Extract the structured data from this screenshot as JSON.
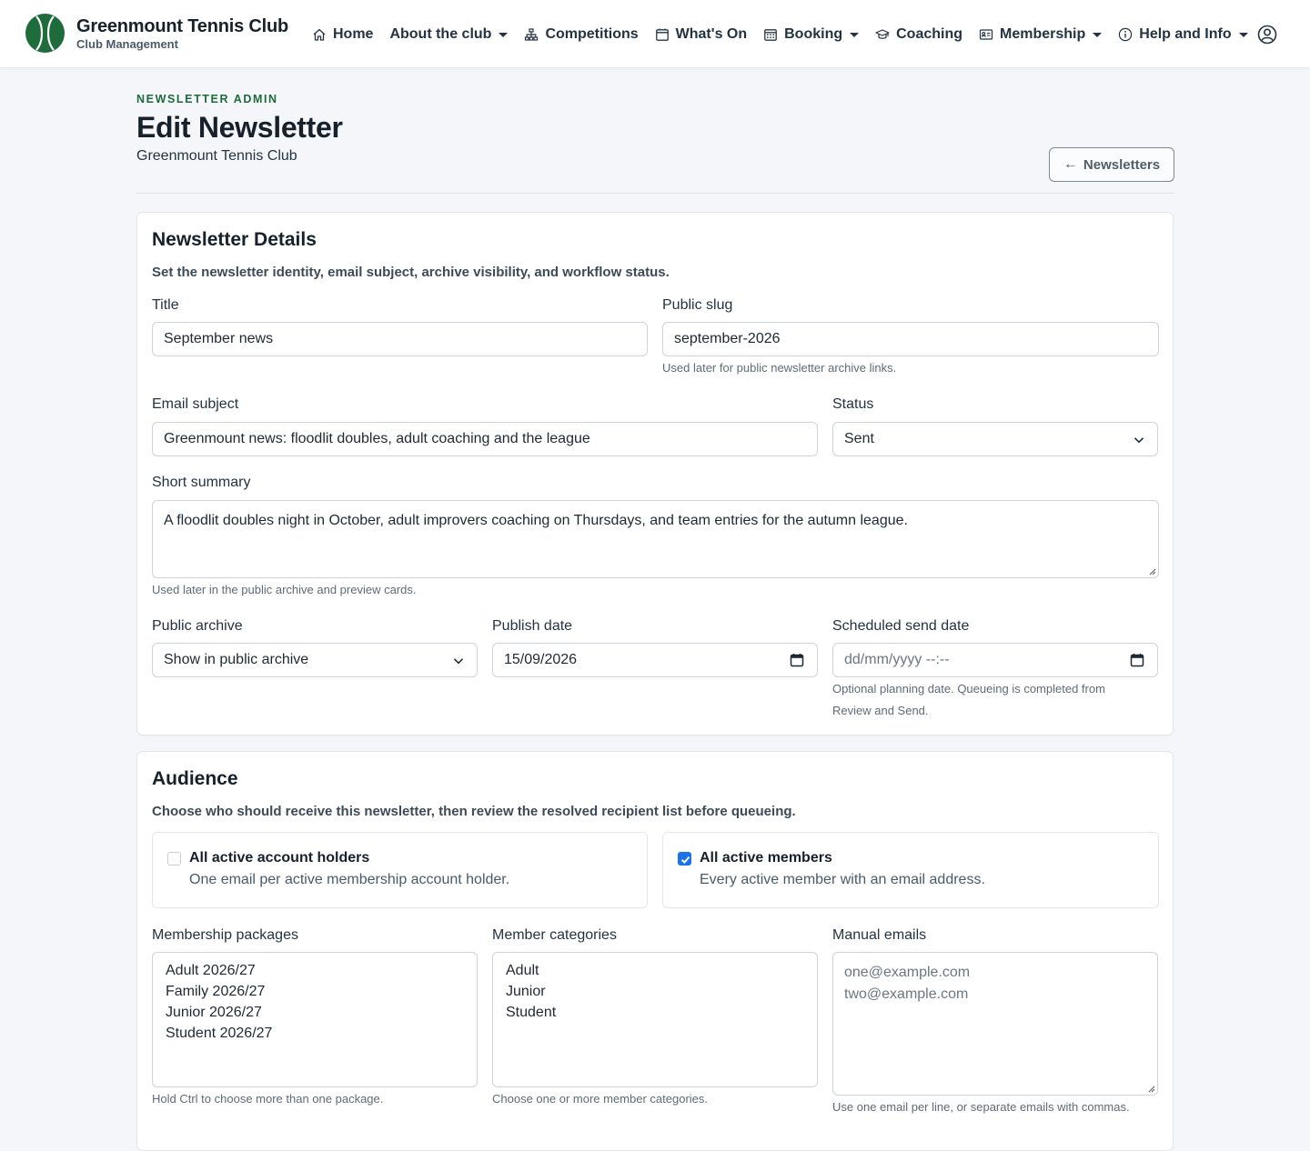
{
  "brand": {
    "name": "Greenmount Tennis Club",
    "subtitle": "Club Management"
  },
  "nav": {
    "items": [
      {
        "label": "Home",
        "icon": "home-icon"
      },
      {
        "label": "About the club",
        "icon": "",
        "dropdown": true
      },
      {
        "label": "Competitions",
        "icon": "sitemap-icon"
      },
      {
        "label": "What's On",
        "icon": "calendar-icon"
      },
      {
        "label": "Booking",
        "icon": "calendar-grid-icon",
        "dropdown": true
      },
      {
        "label": "Coaching",
        "icon": "mortarboard-icon"
      },
      {
        "label": "Membership",
        "icon": "id-card-icon",
        "dropdown": true
      },
      {
        "label": "Help and Info",
        "icon": "info-icon",
        "dropdown": true
      }
    ]
  },
  "header": {
    "kicker": "NEWSLETTER ADMIN",
    "title": "Edit Newsletter",
    "subtitle": "Greenmount Tennis Club",
    "back_button": "Newsletters"
  },
  "details": {
    "title": "Newsletter Details",
    "description": "Set the newsletter identity, email subject, archive visibility, and workflow status.",
    "title_label": "Title",
    "title_value": "September news",
    "slug_label": "Public slug",
    "slug_value": "september-2026",
    "slug_help": "Used later for public newsletter archive links.",
    "subject_label": "Email subject",
    "subject_value": "Greenmount news: floodlit doubles, adult coaching and the league",
    "status_label": "Status",
    "status_value": "Sent",
    "summary_label": "Short summary",
    "summary_value": "A floodlit doubles night in October, adult improvers coaching on Thursdays, and team entries for the autumn league.",
    "summary_help": "Used later in the public archive and preview cards.",
    "archive_label": "Public archive",
    "archive_value": "Show in public archive",
    "publish_label": "Publish date",
    "publish_value": "15/09/2026",
    "scheduled_label": "Scheduled send date",
    "scheduled_placeholder": "dd/mm/yyyy --:--",
    "scheduled_help_1": "Optional planning date. Queueing is completed from",
    "scheduled_help_2": "Review and Send."
  },
  "audience": {
    "title": "Audience",
    "description": "Choose who should receive this newsletter, then review the resolved recipient list before queueing.",
    "option_account_title": "All active account holders",
    "option_account_desc": "One email per active membership account holder.",
    "option_account_checked": false,
    "option_members_title": "All active members",
    "option_members_desc": "Every active member with an email address.",
    "option_members_checked": true,
    "packages_label": "Membership packages",
    "packages": [
      "Adult 2026/27",
      "Family 2026/27",
      "Junior 2026/27",
      "Student 2026/27"
    ],
    "packages_help": "Hold Ctrl to choose more than one package.",
    "categories_label": "Member categories",
    "categories": [
      "Adult",
      "Junior",
      "Student"
    ],
    "categories_help": "Choose one or more member categories.",
    "manual_label": "Manual emails",
    "manual_placeholder_1": "one@example.com",
    "manual_placeholder_2": "two@example.com",
    "manual_help": "Use one email per line, or separate emails with commas."
  },
  "colors": {
    "brand_green": "#1e6b3c",
    "accent_blue": "#1a73e8"
  }
}
